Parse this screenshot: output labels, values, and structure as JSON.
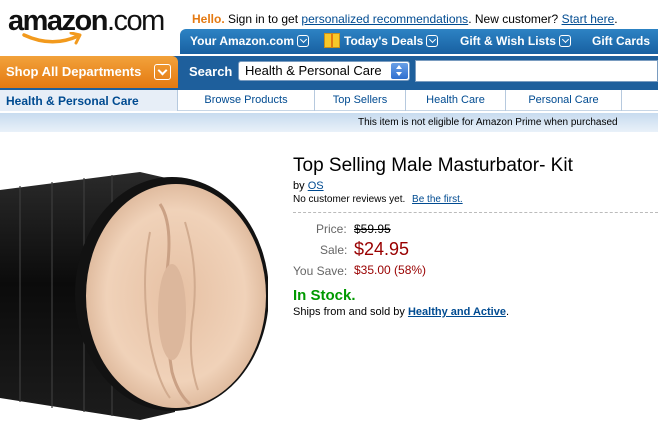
{
  "header": {
    "logo_text": "amazon",
    "logo_suffix": ".com",
    "greeting_hello": "Hello.",
    "greeting_signin": "Sign in to get",
    "greeting_link": "personalized recommendations",
    "greeting_new": ". New customer?",
    "greeting_start": "Start here",
    "greeting_end": "."
  },
  "topnav": {
    "your_amazon": "Your Amazon.com",
    "todays_deals": "Today's Deals",
    "gift_lists": "Gift & Wish Lists",
    "gift_cards": "Gift Cards"
  },
  "search": {
    "shop_all": "Shop All Departments",
    "label": "Search",
    "category": "Health & Personal Care",
    "query": ""
  },
  "subnav": {
    "current": "Health & Personal Care",
    "links": [
      "Browse Products",
      "Top Sellers",
      "Health Care",
      "Personal Care"
    ]
  },
  "notice": {
    "prime": "This item is not eligible for Amazon Prime when purchased"
  },
  "product": {
    "title": "Top Selling Male Masturbator- Kit",
    "by": "by",
    "brand": "OS",
    "no_reviews": "No customer reviews yet.",
    "be_first": "Be the first.",
    "price_label": "Price:",
    "list_price": "$59.95",
    "sale_label": "Sale:",
    "sale_price": "$24.95",
    "save_label": "You Save:",
    "save_amount": "$35.00 (58%)",
    "availability": "In Stock.",
    "ships_text": "Ships from and sold by",
    "seller": "Healthy and Active",
    "ships_end": "."
  },
  "colors": {
    "nav_blue": "#1e5f9c",
    "orange": "#e47911",
    "price_red": "#990000",
    "stock_green": "#009900",
    "link_blue": "#004b91"
  }
}
